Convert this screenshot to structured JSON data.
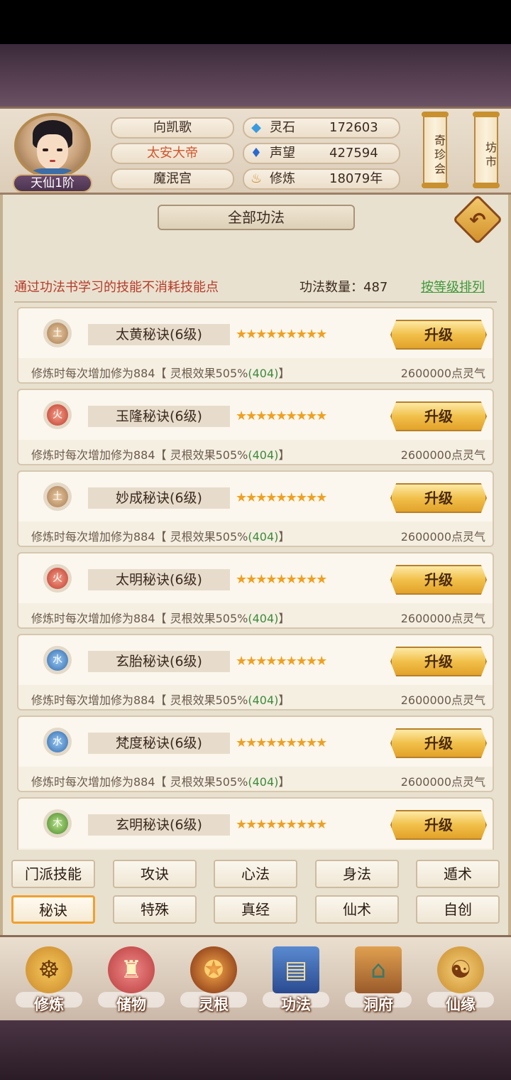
{
  "player": {
    "name": "向凯歌",
    "title": "太安大帝",
    "sect": "魔泯宫",
    "rank": "天仙1阶"
  },
  "resources": [
    {
      "icon": "spirit-stone-icon",
      "label": "灵石",
      "value": "172603"
    },
    {
      "icon": "reputation-icon",
      "label": "声望",
      "value": "427594"
    },
    {
      "icon": "cultivation-icon",
      "label": "修炼",
      "value": "18079年"
    }
  ],
  "side_buttons": {
    "treasure": "奇珍会",
    "market": "坊市"
  },
  "page_title": "全部功法",
  "notice": "通过功法书学习的技能不消耗技能点",
  "count_label": "功法数量：487",
  "sort_link": "按等级排列",
  "skills": [
    {
      "element": "土",
      "element_type": "earth",
      "name": "太黄秘诀(6级)",
      "stars": "★★★★★★★★★",
      "button": "升级",
      "desc": "修炼时每次增加修为884【 灵根效果505%",
      "bonus": "(404)",
      "desc_end": "】",
      "cost": "2600000点灵气"
    },
    {
      "element": "火",
      "element_type": "fire",
      "name": "玉隆秘诀(6级)",
      "stars": "★★★★★★★★★",
      "button": "升级",
      "desc": "修炼时每次增加修为884【 灵根效果505%",
      "bonus": "(404)",
      "desc_end": "】",
      "cost": "2600000点灵气"
    },
    {
      "element": "土",
      "element_type": "earth",
      "name": "妙成秘诀(6级)",
      "stars": "★★★★★★★★★",
      "button": "升级",
      "desc": "修炼时每次增加修为884【 灵根效果505%",
      "bonus": "(404)",
      "desc_end": "】",
      "cost": "2600000点灵气"
    },
    {
      "element": "火",
      "element_type": "fire",
      "name": "太明秘诀(6级)",
      "stars": "★★★★★★★★★",
      "button": "升级",
      "desc": "修炼时每次增加修为884【 灵根效果505%",
      "bonus": "(404)",
      "desc_end": "】",
      "cost": "2600000点灵气"
    },
    {
      "element": "水",
      "element_type": "water",
      "name": "玄胎秘诀(6级)",
      "stars": "★★★★★★★★★",
      "button": "升级",
      "desc": "修炼时每次增加修为884【 灵根效果505%",
      "bonus": "(404)",
      "desc_end": "】",
      "cost": "2600000点灵气"
    },
    {
      "element": "水",
      "element_type": "water",
      "name": "梵度秘诀(6级)",
      "stars": "★★★★★★★★★",
      "button": "升级",
      "desc": "修炼时每次增加修为884【 灵根效果505%",
      "bonus": "(404)",
      "desc_end": "】",
      "cost": "2600000点灵气"
    },
    {
      "element": "木",
      "element_type": "wood",
      "name": "玄明秘诀(6级)",
      "stars": "★★★★★★★★★",
      "button": "升级",
      "desc": "",
      "bonus": "",
      "desc_end": "",
      "cost": ""
    }
  ],
  "category_tabs": [
    {
      "label": "门派技能",
      "active": false
    },
    {
      "label": "攻诀",
      "active": false
    },
    {
      "label": "心法",
      "active": false
    },
    {
      "label": "身法",
      "active": false
    },
    {
      "label": "遁术",
      "active": false
    },
    {
      "label": "秘诀",
      "active": true
    },
    {
      "label": "特殊",
      "active": false
    },
    {
      "label": "真经",
      "active": false
    },
    {
      "label": "仙术",
      "active": false
    },
    {
      "label": "自创",
      "active": false
    }
  ],
  "bottom_nav": [
    {
      "label": "修炼",
      "icon": "meditating-monk-icon"
    },
    {
      "label": "储物",
      "icon": "bag-icon"
    },
    {
      "label": "灵根",
      "icon": "spirit-root-icon"
    },
    {
      "label": "功法",
      "icon": "book-icon"
    },
    {
      "label": "洞府",
      "icon": "pavilion-icon"
    },
    {
      "label": "仙缘",
      "icon": "gourd-icon"
    }
  ],
  "colors": {
    "accent_gold": "#f1c04a",
    "notice_red": "#b63a2a",
    "link_green": "#3c9a3a",
    "panel_bg": "#e9e1cf"
  }
}
